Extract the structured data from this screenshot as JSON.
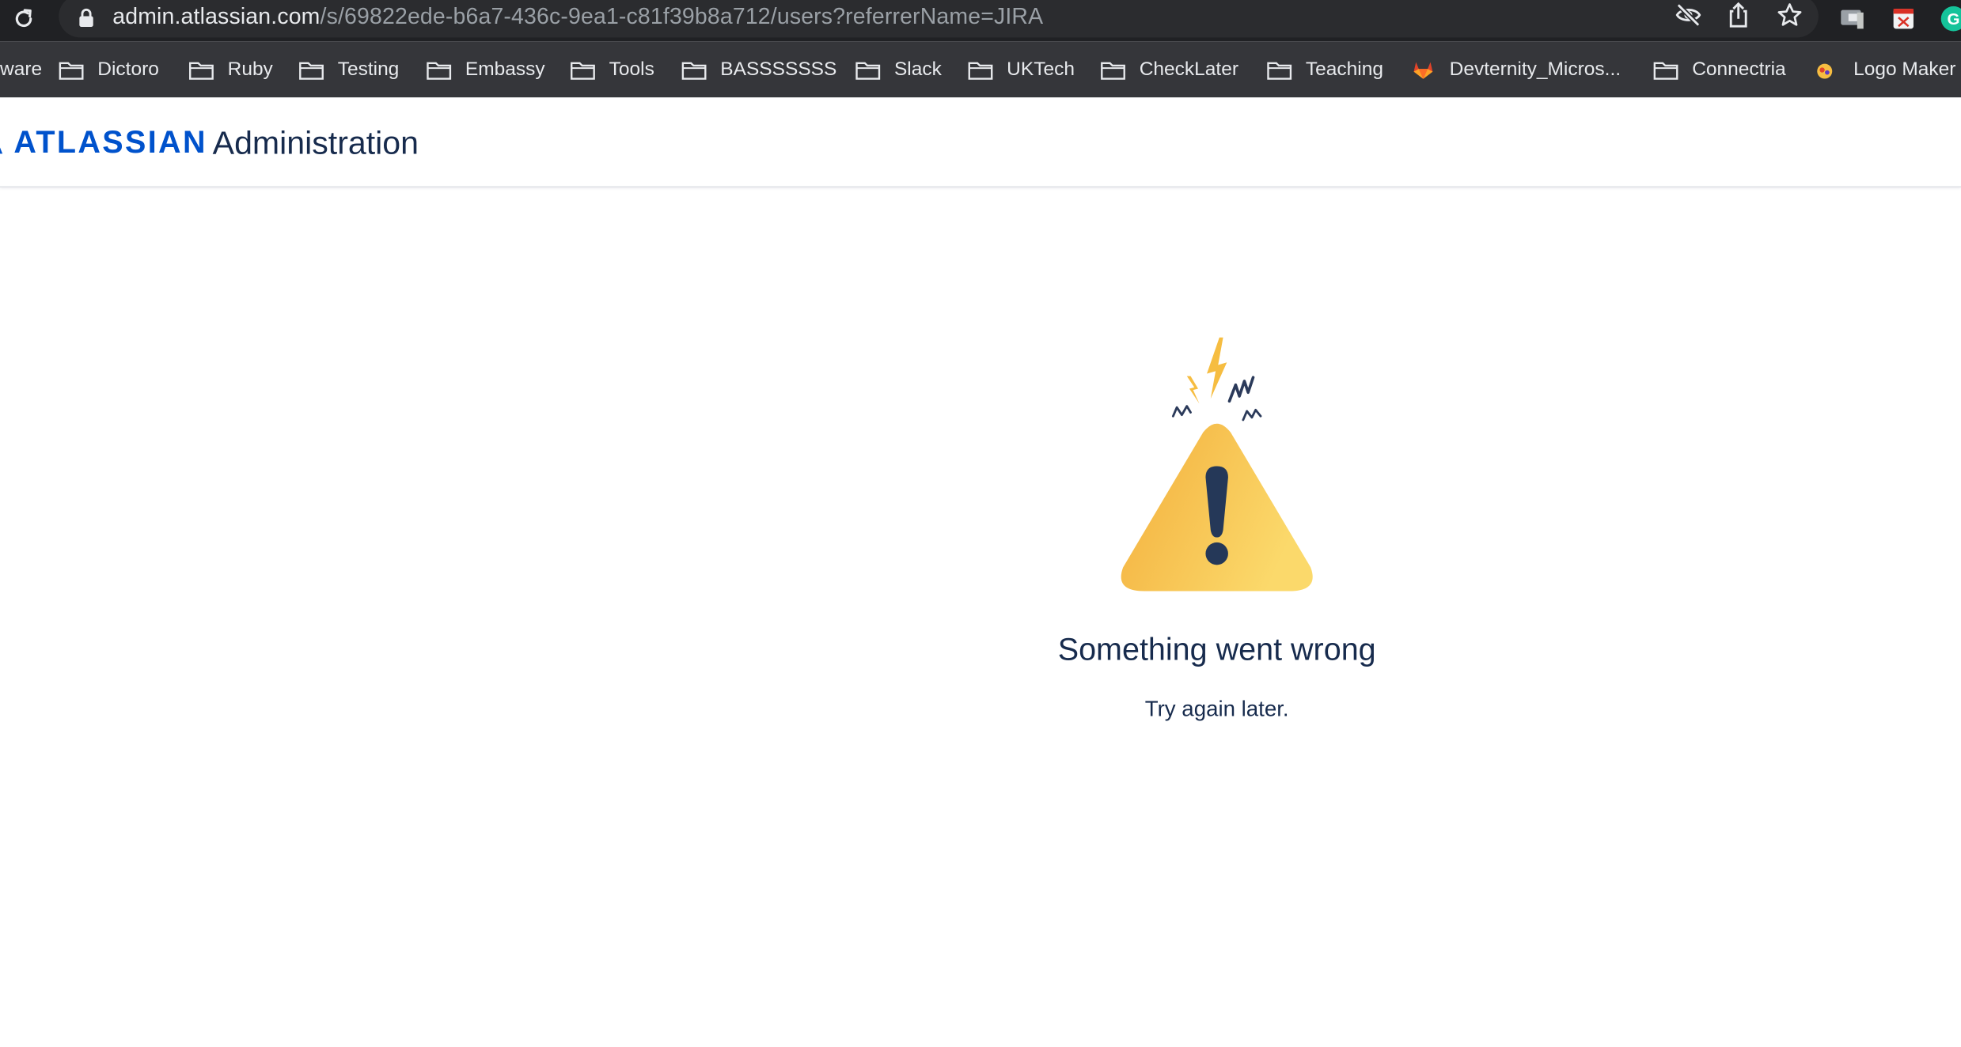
{
  "browser": {
    "url_host": "admin.atlassian.com",
    "url_path": "/s/69822ede-b6a7-436c-9ea1-c81f39b8a712/users?referrerName=JIRA",
    "bookmarks": [
      {
        "label": "ware",
        "icon": "folder-icon"
      },
      {
        "label": "Dictoro",
        "icon": "folder-icon"
      },
      {
        "label": "Ruby",
        "icon": "folder-icon"
      },
      {
        "label": "Testing",
        "icon": "folder-icon"
      },
      {
        "label": "Embassy",
        "icon": "folder-icon"
      },
      {
        "label": "Tools",
        "icon": "folder-icon"
      },
      {
        "label": "BASSSSSSS",
        "icon": "folder-icon"
      },
      {
        "label": "Slack",
        "icon": "folder-icon"
      },
      {
        "label": "UKTech",
        "icon": "folder-icon"
      },
      {
        "label": "CheckLater",
        "icon": "folder-icon"
      },
      {
        "label": "Teaching",
        "icon": "folder-icon"
      },
      {
        "label": "Devternity_Micros...",
        "icon": "gitlab-icon"
      },
      {
        "label": "Connectria",
        "icon": "folder-icon"
      },
      {
        "label": "Logo Maker",
        "icon": "logo-maker-icon"
      }
    ]
  },
  "header": {
    "brand": "ATLASSIAN",
    "title": "Administration"
  },
  "error": {
    "heading": "Something went wrong",
    "message": "Try again later."
  },
  "colors": {
    "brand_blue": "#0052cc",
    "text_dark": "#172b4d",
    "warning_yellow": "#f6bd41",
    "toolbar_bg": "#202124",
    "bookmarks_bg": "#35363a"
  }
}
